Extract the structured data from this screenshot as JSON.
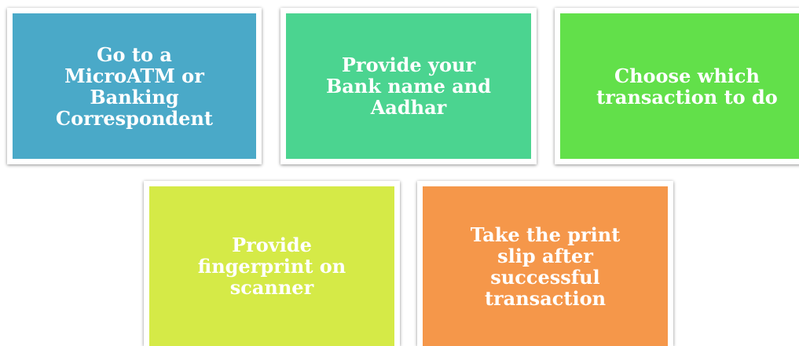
{
  "steps": [
    {
      "label": "Go to a\nMicroATM or\nBanking\nCorrespondent",
      "color": "#4aa9c8"
    },
    {
      "label": "Provide your\nBank name and\nAadhar",
      "color": "#4bd490"
    },
    {
      "label": "Choose which\ntransaction to do",
      "color": "#62e04a"
    },
    {
      "label": "Provide\nfingerprint on\nscanner",
      "color": "#d5ea47"
    },
    {
      "label": "Take the print\nslip after\nsuccessful\ntransaction",
      "color": "#f5974a"
    }
  ]
}
